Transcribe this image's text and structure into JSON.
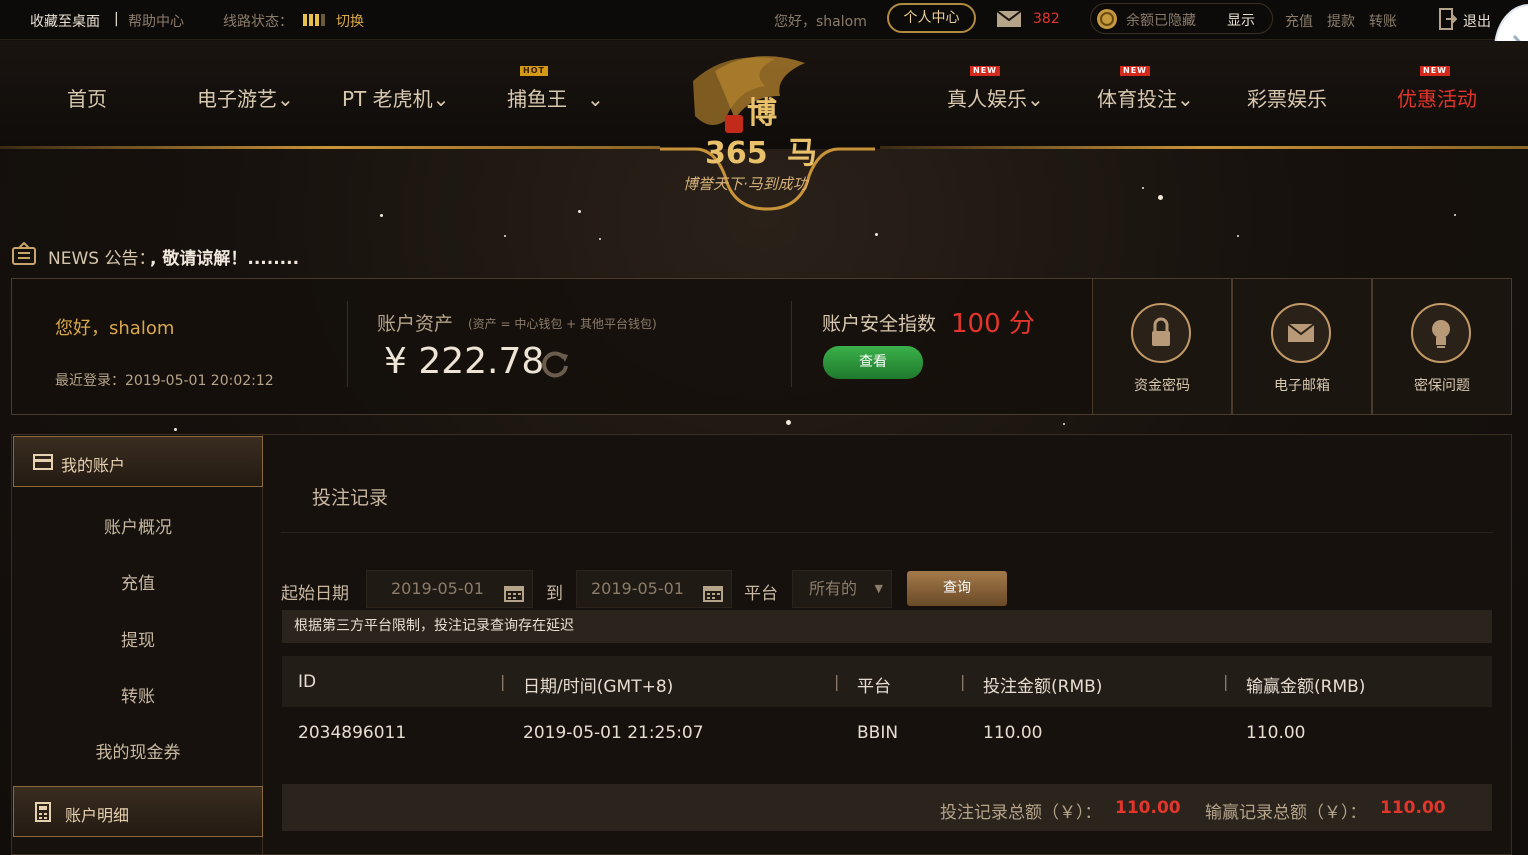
{
  "topbar": {
    "bookmark": "收藏至桌面",
    "help": "帮助中心",
    "line_status": "线路状态：",
    "switch": "切换",
    "greeting": "您好，shalom",
    "personal_center": "个人中心",
    "mail_count": "382",
    "balance_hidden": "余额已隐藏",
    "show": "显示",
    "deposit": "充值",
    "withdraw": "提款",
    "transfer": "转账",
    "logout": "退出"
  },
  "nav": {
    "items": [
      {
        "label": "首页"
      },
      {
        "label": "电子游艺"
      },
      {
        "label": "PT 老虎机"
      },
      {
        "label": "捕鱼王",
        "badge": "HOT"
      },
      {
        "label": "真人娱乐",
        "badge": "NEW"
      },
      {
        "label": "体育投注",
        "badge": "NEW"
      },
      {
        "label": "彩票娱乐"
      },
      {
        "label": "优惠活动",
        "badge": "NEW"
      }
    ],
    "logo_slogan": "博誉天下·马到成功"
  },
  "news": {
    "prefix": "NEWS 公告：",
    "text": ", 敬请谅解！........"
  },
  "account": {
    "greeting": "您好，shalom",
    "last_login_label": "最近登录：",
    "last_login": "2019-05-01 20:02:12",
    "assets_label": "账户资产",
    "assets_note": "(资产 = 中心钱包 + 其他平台钱包)",
    "assets_value": "¥ 222.78",
    "security_label": "账户安全指数",
    "security_score": "100 分",
    "view_button": "查看",
    "tiles": [
      {
        "label": "资金密码",
        "icon": "lock-icon"
      },
      {
        "label": "电子邮箱",
        "icon": "envelope-icon"
      },
      {
        "label": "密保问题",
        "icon": "lightbulb-icon"
      }
    ]
  },
  "sidebar": {
    "section1": "我的账户",
    "items": [
      "账户概况",
      "充值",
      "提现",
      "转账",
      "我的现金券"
    ],
    "section2": "账户明细"
  },
  "main": {
    "title": "投注记录",
    "start_date_label": "起始日期",
    "start_date": "2019-05-01",
    "to_label": "到",
    "end_date": "2019-05-01",
    "platform_label": "平台",
    "platform_value": "所有的",
    "query_button": "查询",
    "notice": "根据第三方平台限制，投注记录查询存在延迟",
    "columns": [
      "ID",
      "日期/时间(GMT+8)",
      "平台",
      "投注金额(RMB)",
      "输赢金额(RMB)"
    ],
    "rows": [
      [
        "2034896011",
        "2019-05-01 21:25:07",
        "BBIN",
        "110.00",
        "110.00"
      ]
    ],
    "bet_total_label": "投注记录总额（￥）：",
    "bet_total": "110.00",
    "win_total_label": "输赢记录总额（￥）：",
    "win_total": "110.00"
  },
  "colors": {
    "accent_gold": "#d9a84a",
    "accent_red": "#e2352b",
    "button_green": "#2a9a3a",
    "background": "#120e0b"
  }
}
